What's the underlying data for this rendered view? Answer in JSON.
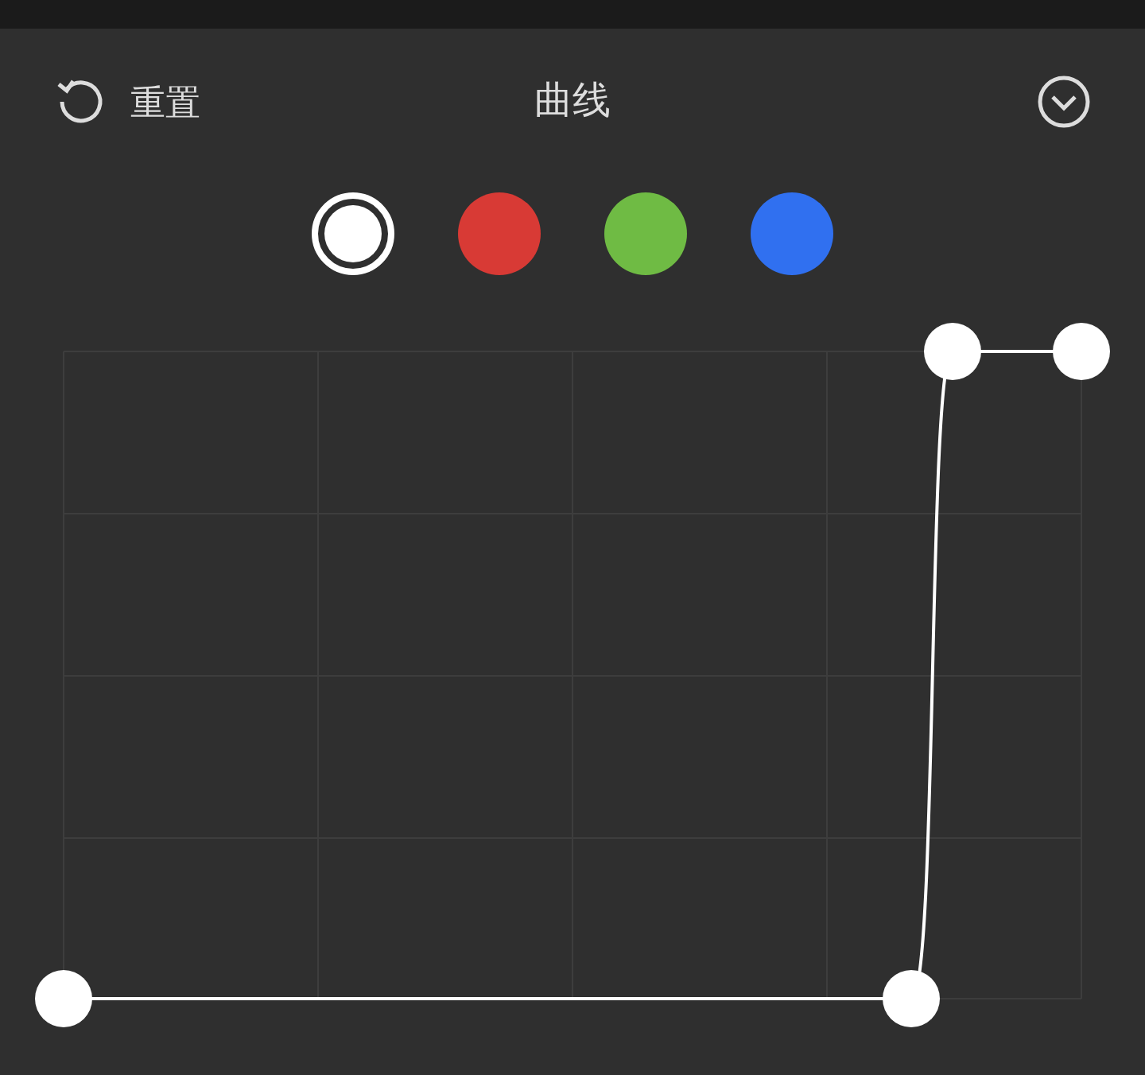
{
  "header": {
    "reset_label": "重置",
    "title": "曲线"
  },
  "channels": [
    {
      "color": "#ffffff",
      "selected": true
    },
    {
      "color": "#d83a35",
      "selected": false
    },
    {
      "color": "#6fbb44",
      "selected": false
    },
    {
      "color": "#3070f0",
      "selected": false
    }
  ]
}
